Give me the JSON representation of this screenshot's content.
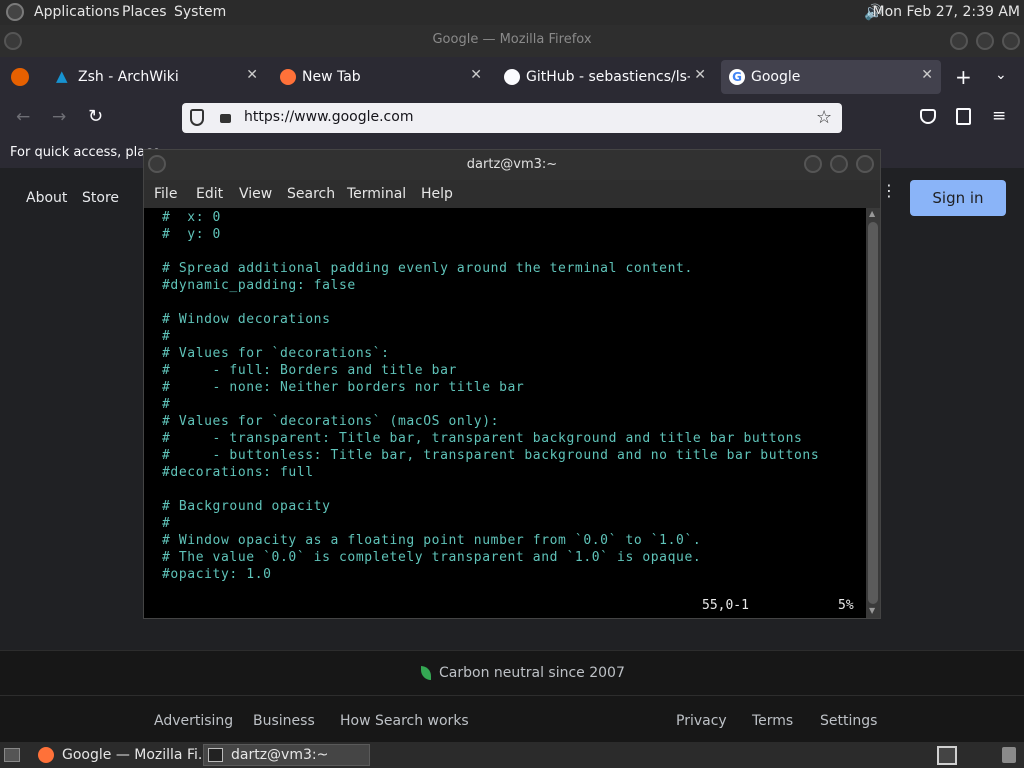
{
  "panel": {
    "menus": [
      "Applications",
      "Places",
      "System"
    ],
    "clock": "Mon Feb 27,  2:39 AM"
  },
  "firefox": {
    "window_title": "Google — Mozilla Firefox",
    "tabs": [
      {
        "label": "Zsh - ArchWiki",
        "icon": "archlinux-icon"
      },
      {
        "label": "New Tab",
        "icon": "firefox-icon"
      },
      {
        "label": "GitHub - sebastiencs/ls-icon",
        "icon": "github-icon"
      },
      {
        "label": "Google",
        "icon": "google-icon",
        "active": true
      }
    ],
    "url": "https://www.google.com",
    "bookmarks_hint": "For quick access, place"
  },
  "google": {
    "nav_left": [
      "About",
      "Store"
    ],
    "signin": "Sign in",
    "carbon": "Carbon neutral since 2007",
    "footer_left": [
      "Advertising",
      "Business",
      "How Search works"
    ],
    "footer_right": [
      "Privacy",
      "Terms",
      "Settings"
    ]
  },
  "terminal": {
    "title": "dartz@vm3:~",
    "menu": [
      "File",
      "Edit",
      "View",
      "Search",
      "Terminal",
      "Help"
    ],
    "lines": [
      "#  x: 0",
      "#  y: 0",
      "",
      "# Spread additional padding evenly around the terminal content.",
      "#dynamic_padding: false",
      "",
      "# Window decorations",
      "#",
      "# Values for `decorations`:",
      "#     - full: Borders and title bar",
      "#     - none: Neither borders nor title bar",
      "#",
      "# Values for `decorations` (macOS only):",
      "#     - transparent: Title bar, transparent background and title bar buttons",
      "#     - buttonless: Title bar, transparent background and no title bar buttons",
      "#decorations: full",
      "",
      "# Background opacity",
      "#",
      "# Window opacity as a floating point number from `0.0` to `1.0`.",
      "# The value `0.0` is completely transparent and `1.0` is opaque.",
      "#opacity: 1.0"
    ],
    "cursor_pos": "55,0-1",
    "scroll_pct": "5%"
  },
  "taskbar": {
    "items": [
      "Google — Mozilla Fi...",
      "dartz@vm3:~"
    ]
  }
}
